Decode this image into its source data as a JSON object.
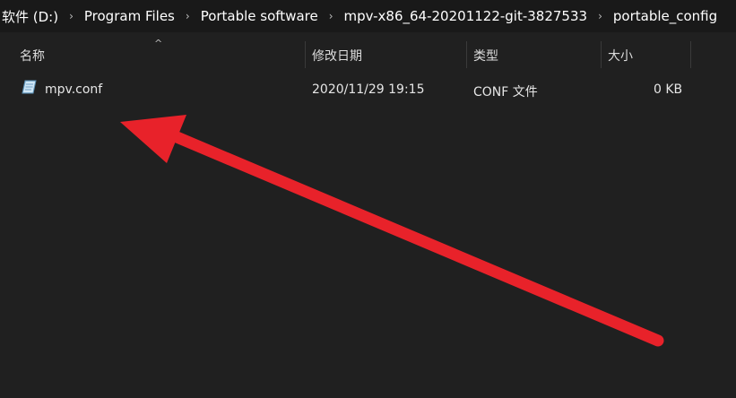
{
  "breadcrumb": {
    "items": [
      "软件 (D:)",
      "Program Files",
      "Portable software",
      "mpv-x86_64-20201122-git-3827533",
      "portable_config"
    ],
    "separator": "›"
  },
  "columns": {
    "name": "名称",
    "modified": "修改日期",
    "type": "类型",
    "size": "大小",
    "sort_indicator": "^"
  },
  "files": [
    {
      "name": "mpv.conf",
      "modified": "2020/11/29 19:15",
      "type": "CONF 文件",
      "size": "0 KB",
      "icon": "config-file-icon"
    }
  ],
  "colors": {
    "background": "#202020",
    "breadcrumb_bg": "#191919",
    "annotation_arrow": "#e8222a"
  },
  "annotation": {
    "icon": "red-arrow-pointing-to-file"
  }
}
